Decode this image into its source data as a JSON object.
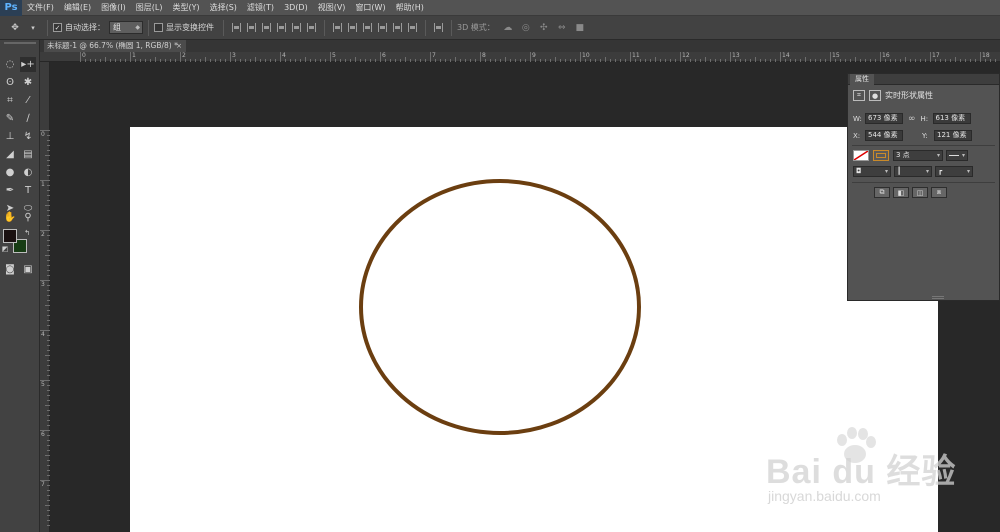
{
  "app": {
    "logo": "Ps",
    "menu": [
      "文件(F)",
      "编辑(E)",
      "图像(I)",
      "图层(L)",
      "类型(Y)",
      "选择(S)",
      "滤镜(T)",
      "3D(D)",
      "视图(V)",
      "窗口(W)",
      "帮助(H)"
    ]
  },
  "options": {
    "tool_icon": "move-tool-icon",
    "auto_select_label": "自动选择：",
    "auto_select_checked": true,
    "auto_select_value": "组",
    "show_transform_label": "显示变换控件",
    "show_transform_checked": false,
    "mode_3d_label": "3D 模式："
  },
  "document": {
    "tab_title": "未标题-1 @ 66.7% (椭圆 1, RGB/8) *",
    "close": "×"
  },
  "ruler": {
    "top_labels": [
      "0",
      "1",
      "2",
      "3",
      "4",
      "5",
      "6",
      "7",
      "8",
      "9",
      "10",
      "11",
      "12",
      "13",
      "14",
      "15",
      "16",
      "17",
      "18",
      "19",
      "20"
    ],
    "left_labels": [
      "0",
      "1",
      "2",
      "3",
      "4",
      "5",
      "6",
      "7",
      "8"
    ]
  },
  "colors": {
    "foreground": "#1a1010",
    "background": "#173c14",
    "ellipse_stroke": "#6b3e10"
  },
  "properties": {
    "tab_label": "属性",
    "title": "实时形状属性",
    "w_label": "W:",
    "w_value": "673 像素",
    "h_label": "H:",
    "h_value": "613 像素",
    "x_label": "X:",
    "x_value": "544 像素",
    "y_label": "Y:",
    "y_value": "121 像素",
    "stroke_size": "3 点"
  },
  "watermark": {
    "main": "Bai du 经验",
    "sub": "jingyan.baidu.com"
  }
}
